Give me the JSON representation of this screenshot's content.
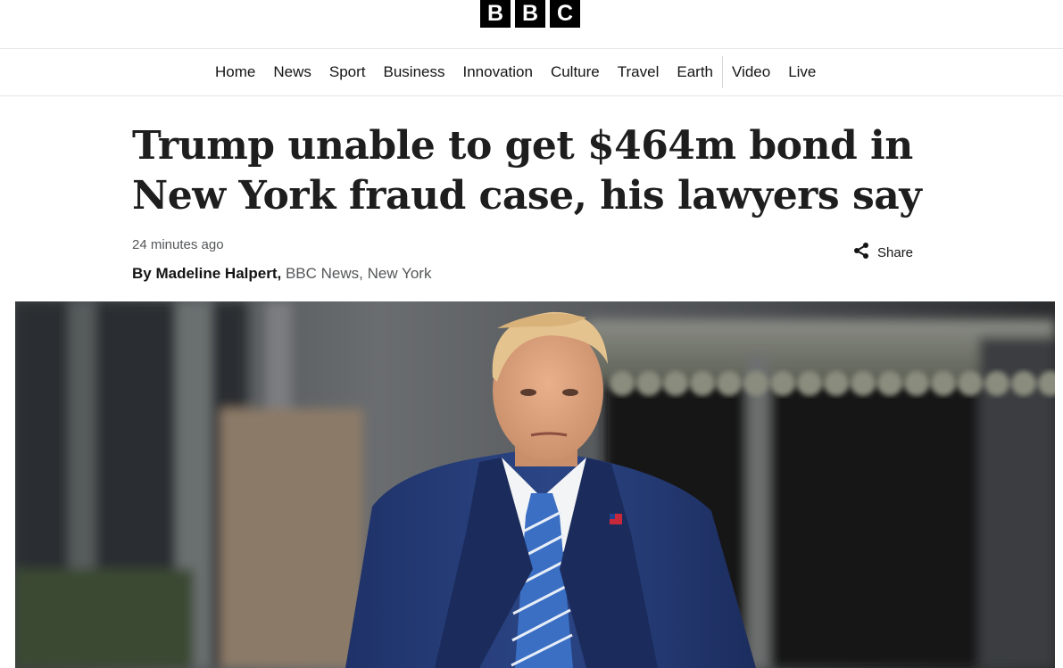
{
  "brand": {
    "letters": [
      "B",
      "B",
      "C"
    ]
  },
  "nav": {
    "items": [
      {
        "label": "Home"
      },
      {
        "label": "News"
      },
      {
        "label": "Sport"
      },
      {
        "label": "Business"
      },
      {
        "label": "Innovation"
      },
      {
        "label": "Culture"
      },
      {
        "label": "Travel"
      },
      {
        "label": "Earth"
      },
      {
        "label": "Video"
      },
      {
        "label": "Live"
      }
    ]
  },
  "article": {
    "headline": "Trump unable to get $464m bond in New York fraud case, his lawyers say",
    "timestamp": "24 minutes ago",
    "byline": {
      "prefix": "By",
      "author": "Madeline Halpert,",
      "org": "BBC News,",
      "location": "New York"
    },
    "share_label": "Share"
  },
  "icons": {
    "share": "share-icon"
  },
  "colors": {
    "text": "#141414",
    "muted": "#545658",
    "logo_bg": "#000000",
    "suit": "#243a73",
    "tie": "#3b6fc4"
  }
}
